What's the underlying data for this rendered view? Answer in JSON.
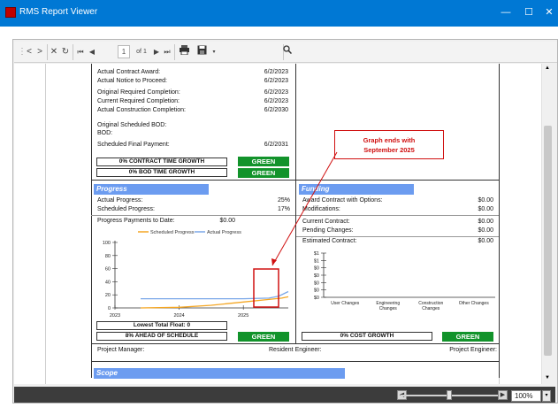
{
  "window": {
    "title": "RMS Report Viewer",
    "minimize": "—",
    "maximize": "☐",
    "close": "✕"
  },
  "toolbar": {
    "page_current": "1",
    "page_of": "of 1"
  },
  "zoom": {
    "value": "100%",
    "level_percent": 100
  },
  "contract": {
    "rows": [
      {
        "label": "Actual Contract Award:",
        "value": "6/2/2023"
      },
      {
        "label": "Actual Notice to Proceed:",
        "value": "6/2/2023"
      },
      {
        "label": "Original Required Completion:",
        "value": "6/2/2023"
      },
      {
        "label": "Current Required Completion:",
        "value": "6/2/2023"
      },
      {
        "label": "Actual Construction Completion:",
        "value": "6/2/2030"
      },
      {
        "label": "Original Scheduled BOD:",
        "value": ""
      },
      {
        "label": "BOD:",
        "value": ""
      },
      {
        "label": "Scheduled Final Payment:",
        "value": "6/2/2031"
      }
    ],
    "time_growth": "0% CONTRACT TIME GROWTH",
    "time_growth_status": "GREEN",
    "bod_growth": "0% BOD TIME GROWTH",
    "bod_growth_status": "GREEN"
  },
  "progress": {
    "title": "Progress",
    "actual_label": "Actual Progress:",
    "actual_value": "25%",
    "scheduled_label": "Scheduled Progress:",
    "scheduled_value": "17%",
    "payments_label": "Progress Payments to Date:",
    "payments_value": "$0.00",
    "float_label": "Lowest Total Float: 0",
    "schedule_label": "8% AHEAD OF SCHEDULE",
    "schedule_status": "GREEN"
  },
  "funding": {
    "title": "Funding",
    "rows": [
      {
        "label": "Award Contract with Options:",
        "value": "$0.00"
      },
      {
        "label": "Modifications:",
        "value": "$0.00"
      },
      {
        "label": "Current Contract:",
        "value": "$0.00"
      },
      {
        "label": "Pending Changes:",
        "value": "$0.00"
      },
      {
        "label": "Estimated Contract:",
        "value": "$0.00"
      }
    ],
    "cost_label": "0% COST GROWTH",
    "cost_status": "GREEN"
  },
  "footer": {
    "pm": "Project Manager:",
    "re": "Resident Engineer:",
    "pe": "Project Engineer:"
  },
  "scope": {
    "title": "Scope"
  },
  "callout": {
    "line1": "Graph ends with",
    "line2": "September 2025"
  },
  "colors": {
    "green": "#12932b",
    "section": "#6c9cf0",
    "callout": "#d01010",
    "scheduled": "#f4a623",
    "actual": "#7aa7e8"
  },
  "chart_data": [
    {
      "type": "line",
      "series": [
        {
          "name": "Scheduled Progress",
          "x": [
            2023.4,
            2024.0,
            2024.5,
            2025.0,
            2025.4,
            2025.6,
            2025.7
          ],
          "values": [
            0,
            1,
            4,
            9,
            13,
            15,
            17
          ]
        },
        {
          "name": "Actual Progress",
          "x": [
            2023.4,
            2024.0,
            2024.5,
            2025.0,
            2025.4,
            2025.55,
            2025.7
          ],
          "values": [
            14,
            14,
            14,
            14,
            15,
            18,
            25
          ]
        }
      ],
      "x_ticks": [
        "2023",
        "2024",
        "2025"
      ],
      "y_ticks": [
        "0",
        "20",
        "40",
        "60",
        "80",
        "100"
      ],
      "ylim": [
        0,
        100
      ],
      "legend": "top"
    },
    {
      "type": "bar",
      "categories": [
        "User Changes",
        "Engineering Changes",
        "Construction Changes",
        "Other Changes"
      ],
      "categories_wrapped": [
        [
          "User Changes"
        ],
        [
          "Engineering",
          "Changes"
        ],
        [
          "Construction",
          "Changes"
        ],
        [
          "Other Changes"
        ]
      ],
      "values": [
        0,
        0,
        0,
        0
      ],
      "y_ticks": [
        "$0",
        "$0",
        "$0",
        "$0",
        "$0",
        "$1",
        "$1"
      ]
    }
  ]
}
